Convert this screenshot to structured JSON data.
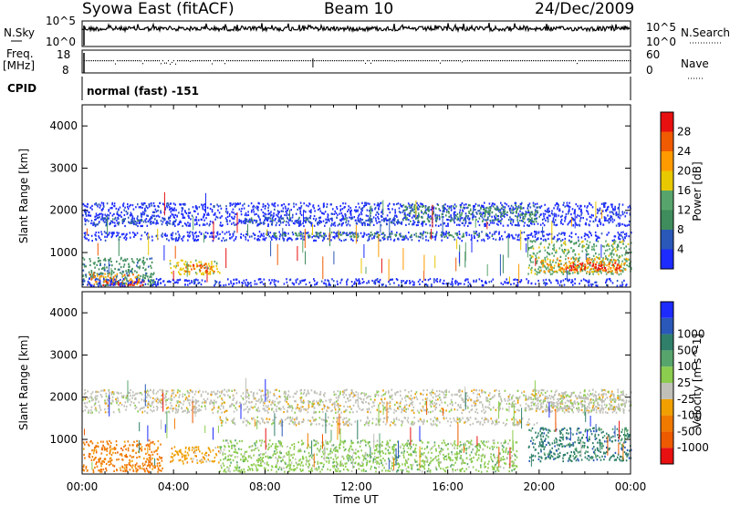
{
  "header": {
    "station": "Syowa East (fitACF)",
    "beam": "Beam 10",
    "date": "24/Dec/2009"
  },
  "noise_panel": {
    "left_label": "N.Sky",
    "right_label": "N.Search",
    "left_ticks": [
      "10^5",
      "10^0"
    ],
    "right_ticks": [
      "10^5",
      "10^0"
    ]
  },
  "freq_panel": {
    "left_label_1": "Freq.",
    "left_label_2": "[MHz]",
    "left_ticks": [
      "18",
      "8"
    ],
    "right_label": "Nave",
    "right_ticks": [
      "60",
      "0"
    ]
  },
  "cpid_panel": {
    "label": "CPID",
    "value": "normal (fast) -151"
  },
  "colors": {
    "power": [
      "#1d2bff",
      "#2a58b8",
      "#3f8c5c",
      "#57a56c",
      "#e8c800",
      "#ff9a00",
      "#f05a00",
      "#e81010"
    ],
    "velocity": [
      "#1d2bff",
      "#2a58b8",
      "#2f7f6a",
      "#57a56c",
      "#8ccc4e",
      "#c0c0b8",
      "#f0a000",
      "#f07a00",
      "#ee5a00",
      "#e81010"
    ]
  },
  "chart_data": [
    {
      "type": "heatmap",
      "title": "Power",
      "ylabel": "Slant Range [km]",
      "colorbar_label": "Power [dB]",
      "colorbar_ticks": [
        "4",
        "8",
        "12",
        "16",
        "20",
        "24",
        "28"
      ],
      "ylim": [
        180,
        4500
      ],
      "y_ticks": [
        "1000",
        "2000",
        "3000",
        "4000"
      ],
      "scatter_bands": [
        {
          "start": 0.0,
          "end": 24.0,
          "range_low": 1650,
          "range_high": 2200,
          "level": 0
        },
        {
          "start": 0.0,
          "end": 24.0,
          "range_low": 1300,
          "range_high": 1520,
          "level": 0
        },
        {
          "start": 0.5,
          "end": 4.0,
          "range_low": 1680,
          "range_high": 1850,
          "level": 1
        },
        {
          "start": 7.0,
          "end": 14.0,
          "range_low": 1700,
          "range_high": 1850,
          "level": 1
        },
        {
          "start": 14.0,
          "end": 20.0,
          "range_low": 1750,
          "range_high": 2150,
          "level": 2
        },
        {
          "start": 8.0,
          "end": 18.0,
          "range_low": 1380,
          "range_high": 1500,
          "level": 2
        },
        {
          "start": 0.0,
          "end": 3.2,
          "range_low": 250,
          "range_high": 900,
          "level": 2
        },
        {
          "start": 0.2,
          "end": 2.5,
          "range_low": 250,
          "range_high": 520,
          "level": 5
        },
        {
          "start": 0.8,
          "end": 3.0,
          "range_low": 230,
          "range_high": 340,
          "level": 7
        },
        {
          "start": 3.8,
          "end": 6.0,
          "range_low": 500,
          "range_high": 850,
          "level": 4
        },
        {
          "start": 4.5,
          "end": 5.8,
          "range_low": 560,
          "range_high": 760,
          "level": 6
        },
        {
          "start": 0.0,
          "end": 24.0,
          "range_low": 230,
          "range_high": 400,
          "level": 0
        },
        {
          "start": 19.5,
          "end": 24.0,
          "range_low": 500,
          "range_high": 1300,
          "level": 3
        },
        {
          "start": 20.0,
          "end": 23.8,
          "range_low": 550,
          "range_high": 900,
          "level": 5
        },
        {
          "start": 21.0,
          "end": 23.5,
          "range_low": 600,
          "range_high": 780,
          "level": 7
        }
      ]
    },
    {
      "type": "heatmap",
      "title": "Velocity",
      "ylabel": "Slant Range [km]",
      "colorbar_label": "Velocity [m s^-1]",
      "colorbar_ticks": [
        "-1000",
        "-500",
        "-100",
        "-25",
        "25",
        "100",
        "500",
        "1000"
      ],
      "ylim": [
        180,
        4500
      ],
      "y_ticks": [
        "1000",
        "2000",
        "3000",
        "4000"
      ],
      "scatter_bands": [
        {
          "start": 0.0,
          "end": 24.0,
          "range_low": 1650,
          "range_high": 2200,
          "level": 5
        },
        {
          "start": 6.0,
          "end": 20.0,
          "range_low": 1350,
          "range_high": 1550,
          "level": 5
        },
        {
          "start": 0.0,
          "end": 3.5,
          "range_low": 250,
          "range_high": 1000,
          "level": 7
        },
        {
          "start": 3.8,
          "end": 6.0,
          "range_low": 450,
          "range_high": 850,
          "level": 6
        },
        {
          "start": 6.0,
          "end": 19.0,
          "range_low": 250,
          "range_high": 1000,
          "level": 4
        },
        {
          "start": 19.5,
          "end": 24.0,
          "range_low": 500,
          "range_high": 1300,
          "level": 2
        },
        {
          "start": 19.5,
          "end": 24.0,
          "range_low": 1700,
          "range_high": 2100,
          "level": 5
        }
      ]
    }
  ],
  "x_axis": {
    "label": "Time UT",
    "ticks": [
      "00:00",
      "04:00",
      "08:00",
      "12:00",
      "16:00",
      "20:00",
      "00:00"
    ]
  }
}
